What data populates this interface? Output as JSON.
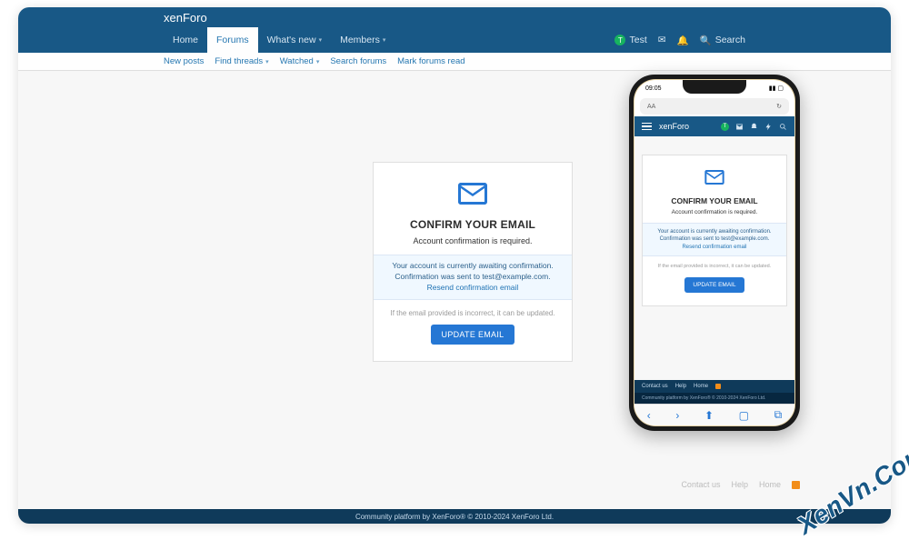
{
  "brand": {
    "part1": "xen",
    "part2": "Foro"
  },
  "nav": {
    "items": [
      {
        "label": "Home"
      },
      {
        "label": "Forums"
      },
      {
        "label": "What's new"
      },
      {
        "label": "Members"
      }
    ],
    "user": "Test",
    "search": "Search"
  },
  "subnav": {
    "items": [
      "New posts",
      "Find threads",
      "Watched",
      "Search forums",
      "Mark forums read"
    ]
  },
  "card": {
    "title": "CONFIRM YOUR EMAIL",
    "subtitle": "Account confirmation is required.",
    "msg1": "Your account is currently awaiting confirmation.",
    "msg2": "Confirmation was sent to test@example.com.",
    "resend": "Resend confirmation email",
    "hint": "If the email provided is incorrect, it can be updated.",
    "button": "UPDATE EMAIL"
  },
  "phone": {
    "time": "09:05",
    "aa": "AA",
    "footer": {
      "contact": "Contact us",
      "help": "Help",
      "home": "Home"
    },
    "copy": "Community platform by XenForo® © 2010-2024 XenForo Ltd."
  },
  "footer": {
    "contact": "Contact us",
    "help": "Help",
    "home": "Home"
  },
  "copy": "Community platform by XenForo® © 2010-2024 XenForo Ltd.",
  "watermark": "XenVn.Com"
}
